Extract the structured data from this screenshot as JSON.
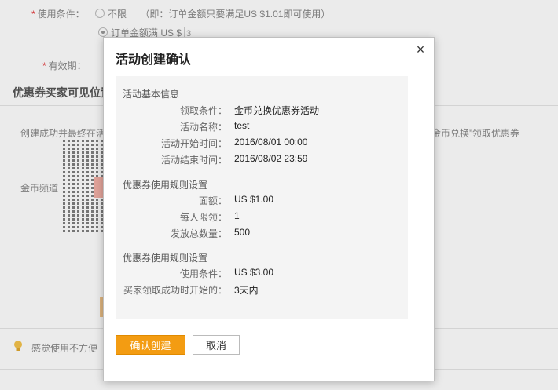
{
  "background": {
    "usage_label": "使用条件：",
    "option_unlimited": "不限",
    "option_unlimited_note": "（即：订单金额只要满足US $1.01即可使用）",
    "option_threshold": "订单金额满 US $",
    "threshold_value": "3",
    "validity_label": "有效期：",
    "visibility_title": "优惠券买家可见位置",
    "success_text_left": "创建成功并最终在活",
    "success_text_right": "金币兑换”领取优惠券",
    "coin_channel": "金币频道",
    "tip_text": "感觉使用不方便"
  },
  "modal": {
    "title": "活动创建确认",
    "close_symbol": "×",
    "basic": {
      "title": "活动基本信息",
      "rows": [
        {
          "label": "领取条件：",
          "value": "金币兑换优惠券活动"
        },
        {
          "label": "活动名称：",
          "value": "test"
        },
        {
          "label": "活动开始时间：",
          "value": "2016/08/01 00:00"
        },
        {
          "label": "活动结束时间：",
          "value": "2016/08/02 23:59"
        }
      ]
    },
    "rules1": {
      "title": "优惠券使用规则设置",
      "rows": [
        {
          "label": "面额：",
          "value": "US $1.00"
        },
        {
          "label": "每人限领：",
          "value": "1"
        },
        {
          "label": "发放总数量：",
          "value": "500"
        }
      ]
    },
    "rules2": {
      "title": "优惠券使用规则设置",
      "rows": [
        {
          "label": "使用条件：",
          "value": "US $3.00"
        },
        {
          "label": "买家领取成功时开始的：",
          "value": "3天内"
        }
      ]
    },
    "confirm_label": "确认创建",
    "cancel_label": "取消"
  },
  "colors": {
    "primary": "#f39c12",
    "required": "#e4393c"
  }
}
